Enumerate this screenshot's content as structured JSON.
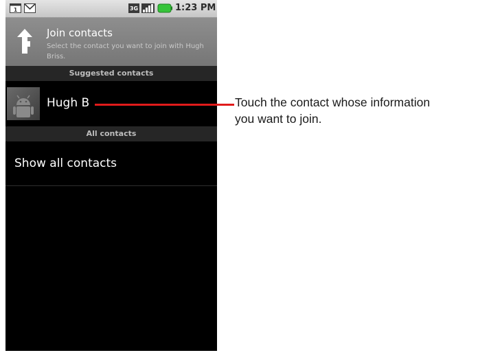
{
  "status_bar": {
    "time": "1:23 PM",
    "network_label": "3G",
    "icons": [
      "calendar-notification-icon",
      "gmail-notification-icon",
      "3g-icon",
      "signal-icon",
      "battery-icon"
    ]
  },
  "header": {
    "title": "Join contacts",
    "subtitle": "Select the contact you want to join with Hugh Briss."
  },
  "sections": {
    "suggested": "Suggested contacts",
    "all": "All contacts"
  },
  "suggested_contacts": [
    {
      "name": "Hugh B"
    }
  ],
  "show_all_label": "Show all contacts",
  "callout": {
    "text": "Touch the contact whose information\nyou want to join."
  },
  "colors": {
    "callout_line": "#e01b1b",
    "screen_background": "#000000",
    "section_header": "#262626",
    "title_bar": "#868686"
  }
}
